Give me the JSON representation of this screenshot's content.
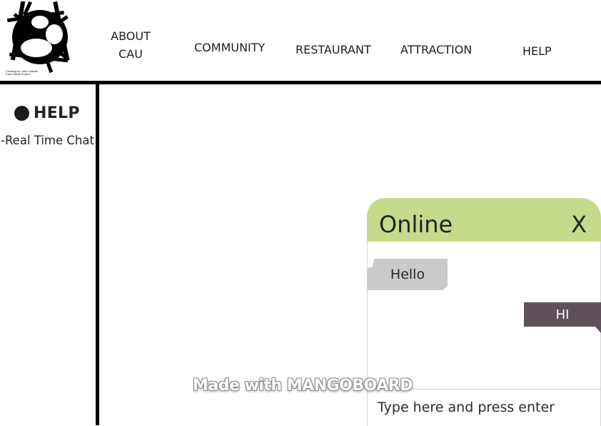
{
  "header": {
    "logo_icon": "nest-with-eggs-icon",
    "logo_caption_line1": "Creating by John Casella",
    "logo_caption_line2": "Farm Nests Project",
    "nav": {
      "about_line1": "ABOUT",
      "about_line2": "CAU",
      "community": "COMMUNITY",
      "restaurant": "RESTAURANT",
      "attraction": "ATTRACTION",
      "help": "HELP"
    }
  },
  "sidebar": {
    "title": "HELP",
    "bullet_icon": "filled-circle-icon",
    "items": [
      {
        "label": "-Real Time Chat"
      }
    ]
  },
  "chat": {
    "status": "Online",
    "close_label": "X",
    "header_color": "#c5da8c",
    "messages": [
      {
        "from": "them",
        "text": "Hello"
      },
      {
        "from": "me",
        "text": "HI"
      }
    ],
    "incoming_color": "#cacaca",
    "outgoing_color": "#5e5159",
    "input_placeholder": "Type here and press enter"
  },
  "watermark": "Made with MANGOBOARD"
}
